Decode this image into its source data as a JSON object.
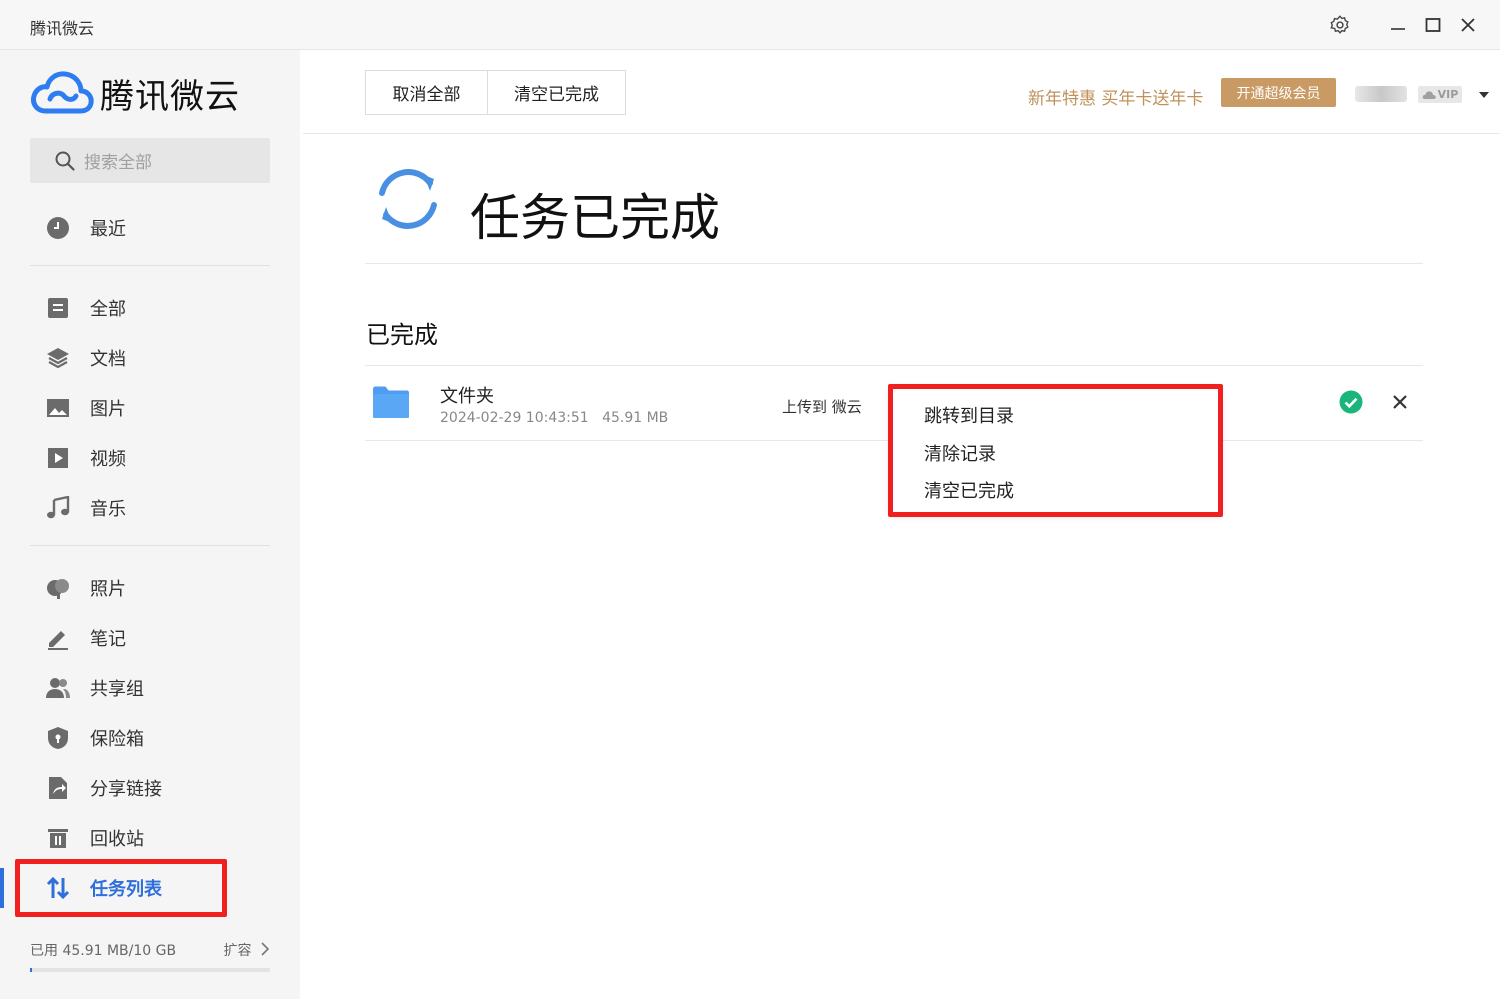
{
  "window": {
    "title": "腾讯微云"
  },
  "sidebar": {
    "logo_text": "腾讯微云",
    "search_placeholder": "搜索全部",
    "items": [
      {
        "label": "最近",
        "icon": "clock-icon"
      },
      {
        "label": "全部",
        "icon": "document-icon"
      },
      {
        "label": "文档",
        "icon": "layers-icon"
      },
      {
        "label": "图片",
        "icon": "image-icon"
      },
      {
        "label": "视频",
        "icon": "play-icon"
      },
      {
        "label": "音乐",
        "icon": "music-note-icon"
      },
      {
        "label": "照片",
        "icon": "photos-icon"
      },
      {
        "label": "笔记",
        "icon": "pen-icon"
      },
      {
        "label": "共享组",
        "icon": "group-icon"
      },
      {
        "label": "保险箱",
        "icon": "shield-icon"
      },
      {
        "label": "分享链接",
        "icon": "share-link-icon"
      },
      {
        "label": "回收站",
        "icon": "trash-icon"
      },
      {
        "label": "任务列表",
        "icon": "transfer-arrows-icon",
        "active": true
      }
    ],
    "storage": {
      "used_text": "已用 45.91 MB/10 GB",
      "expand_label": "扩容",
      "used_fraction": 0.0045
    }
  },
  "toolbar": {
    "cancel_all": "取消全部",
    "clear_completed": "清空已完成"
  },
  "header": {
    "promo_text": "新年特惠 买年卡送年卡",
    "vip_button": "开通超级会员",
    "vip_badge": "VIP"
  },
  "main": {
    "status_title": "任务已完成",
    "section_title": "已完成",
    "task": {
      "name": "文件夹",
      "datetime": "2024-02-29 10:43:51",
      "size": "45.91 MB",
      "destination": "上传到 微云"
    },
    "context_menu": [
      "跳转到目录",
      "清除记录",
      "清空已完成"
    ]
  },
  "colors": {
    "accent": "#2f6fdc",
    "vip_gold": "#c99a63",
    "success": "#1ab57a",
    "highlight_red": "#f02020"
  }
}
